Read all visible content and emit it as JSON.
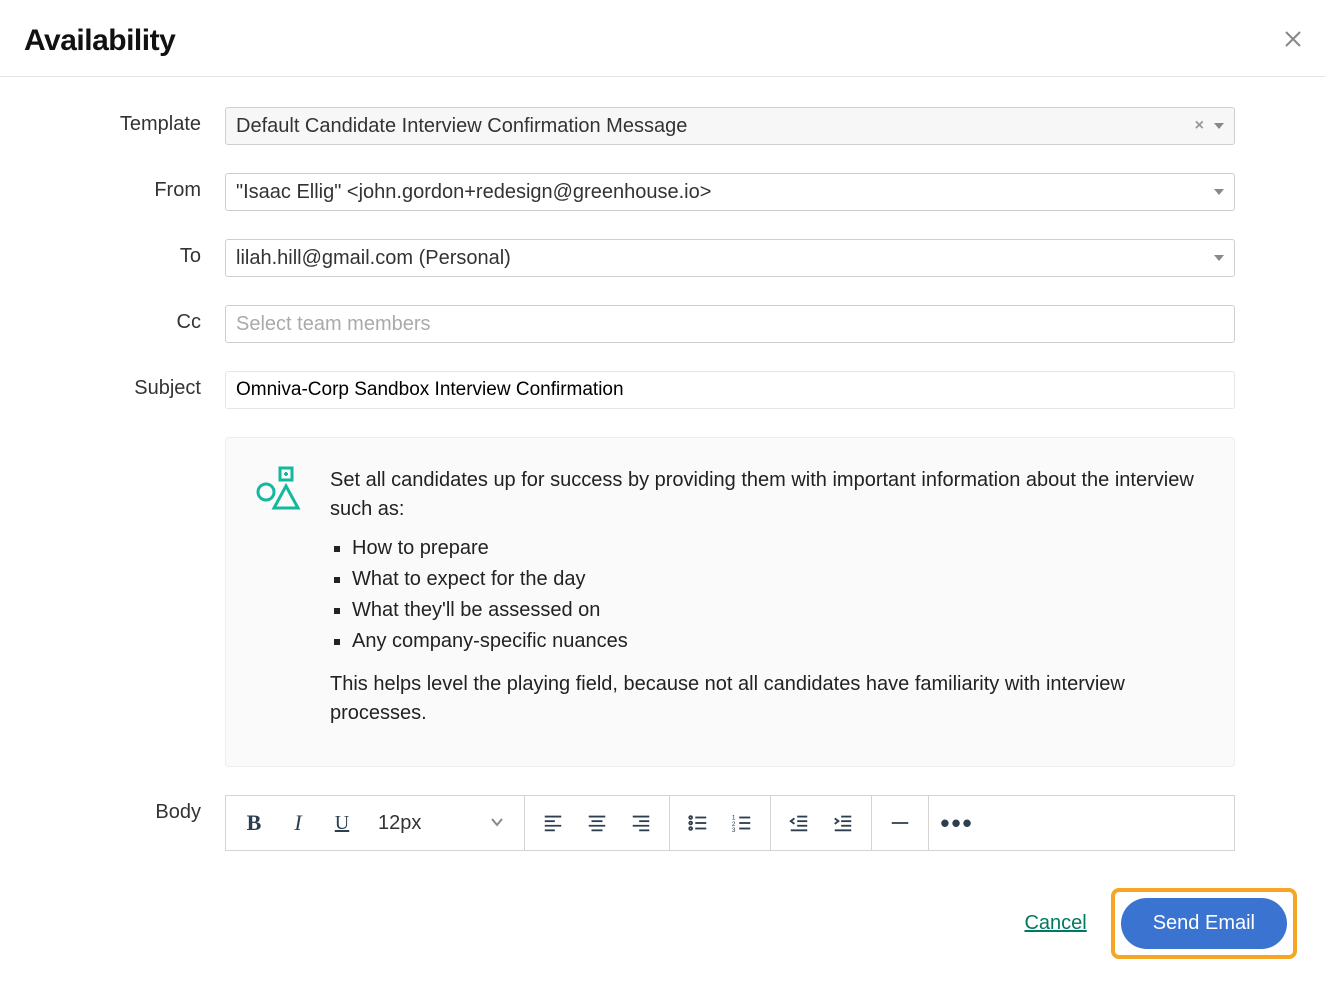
{
  "header": {
    "title": "Availability"
  },
  "labels": {
    "template": "Template",
    "from": "From",
    "to": "To",
    "cc": "Cc",
    "subject": "Subject",
    "body": "Body"
  },
  "fields": {
    "template_value": "Default Candidate Interview Confirmation Message",
    "from_value": "\"Isaac Ellig\" <john.gordon+redesign@greenhouse.io>",
    "to_value": "lilah.hill@gmail.com (Personal)",
    "cc_placeholder": "Select team members",
    "subject_value": "Omniva-Corp Sandbox Interview Confirmation"
  },
  "info": {
    "intro": "Set all candidates up for success by providing them with important information about the interview such as:",
    "bullets": [
      "How to prepare",
      "What to expect for the day",
      "What they'll be assessed on",
      "Any company-specific nuances"
    ],
    "outro": "This helps level the playing field, because not all candidates have familiarity with interview processes."
  },
  "toolbar": {
    "font_size": "12px"
  },
  "footer": {
    "cancel": "Cancel",
    "send": "Send Email"
  }
}
